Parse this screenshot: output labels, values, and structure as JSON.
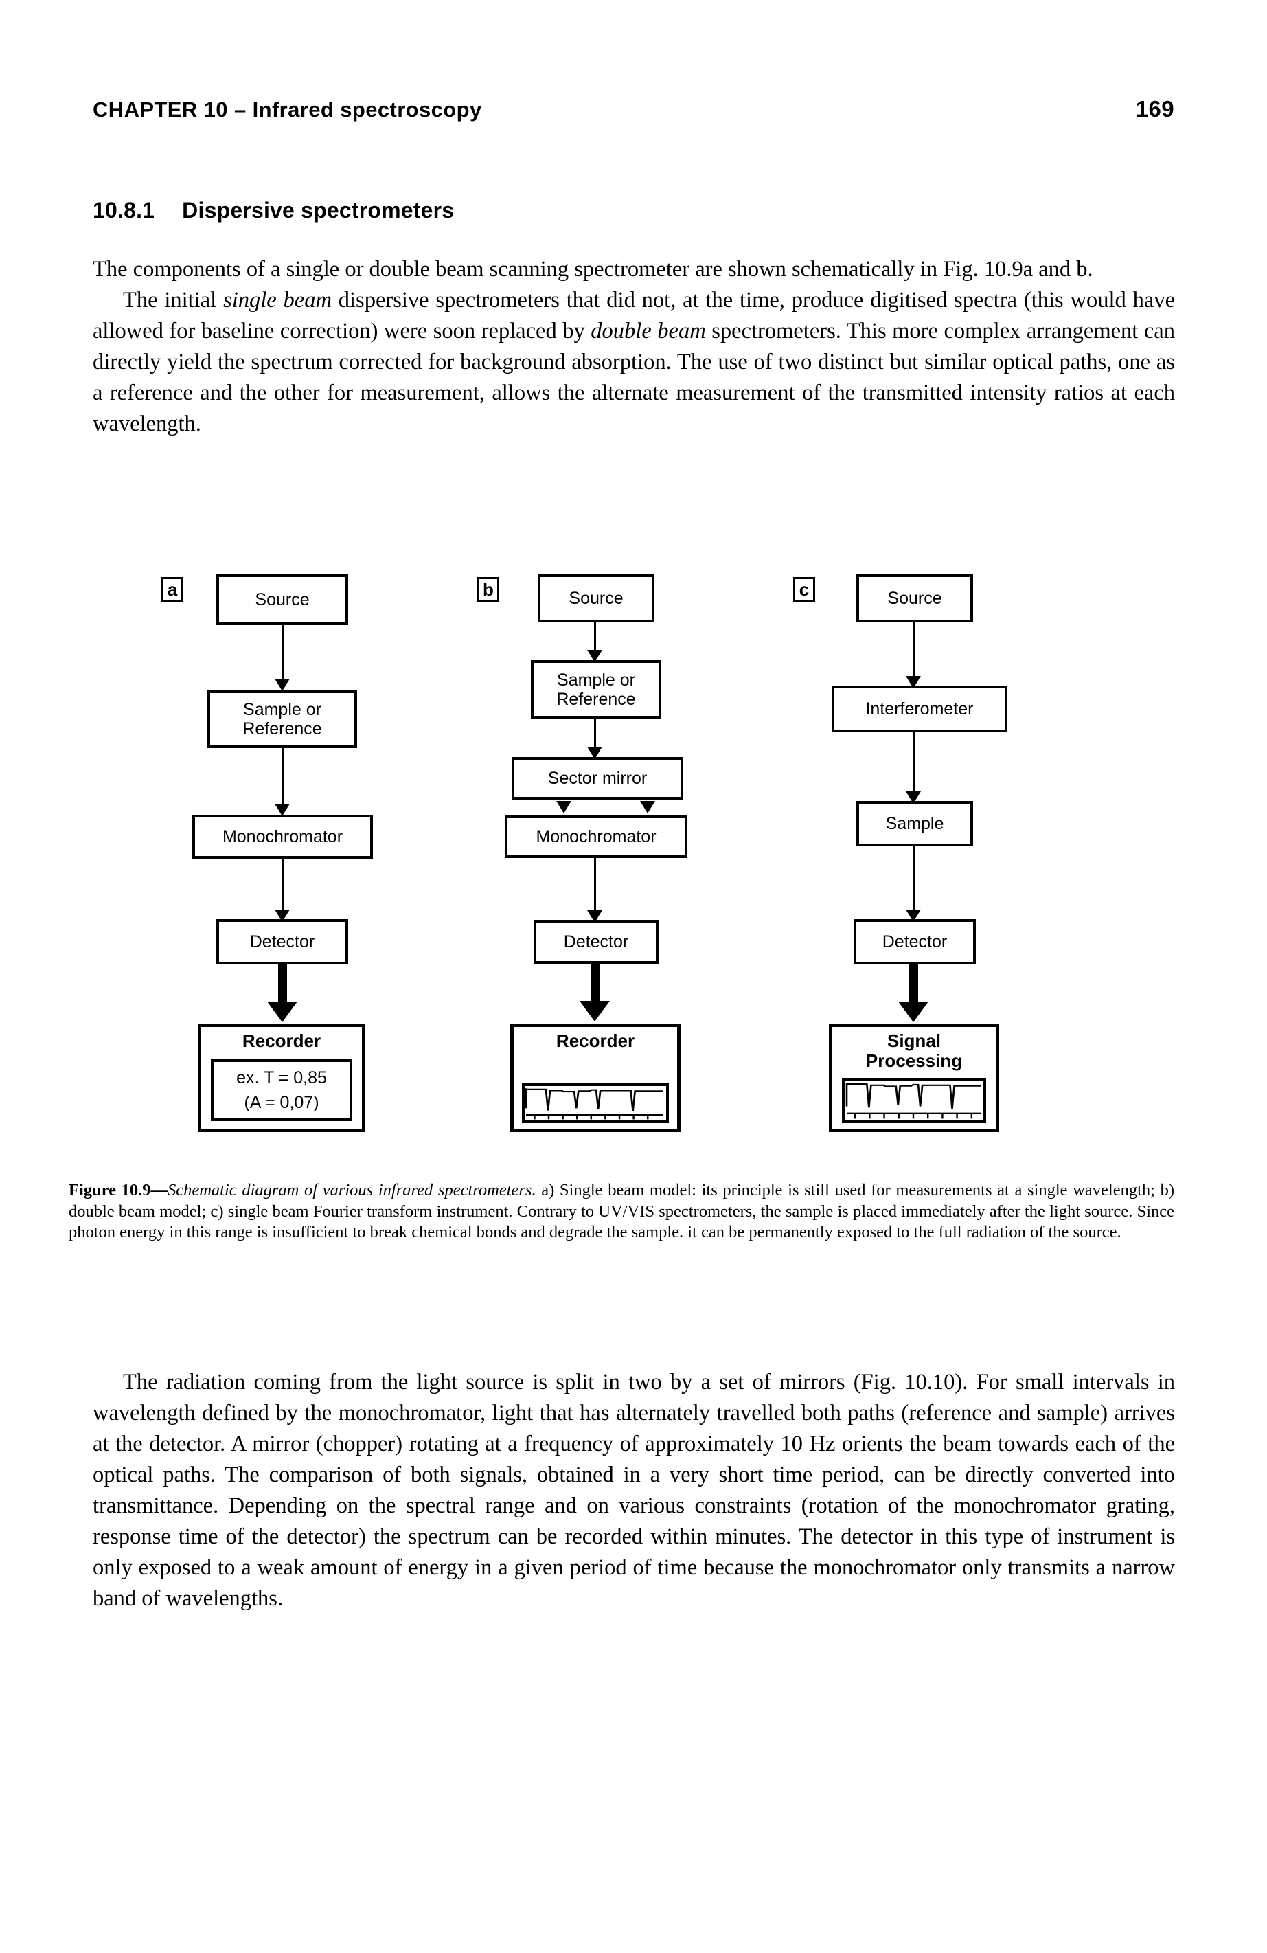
{
  "runhead": {
    "chapter": "CHAPTER 10 – Infrared spectroscopy",
    "page_number": "169"
  },
  "section": {
    "number": "10.8.1",
    "title": "Dispersive spectrometers"
  },
  "paragraphs": {
    "p1_line1": "The components of a single or double beam scanning spectrometer are shown schematically in Fig. 10.9a and b.",
    "p1_a": "The initial ",
    "p1_em1": "single beam",
    "p1_b": " dispersive spectrometers that did not, at the time, produce digitised spectra (this would have allowed for baseline correction) were soon replaced by ",
    "p1_em2": "double beam",
    "p1_c": " spectrometers. This more complex arrangement can directly yield the spectrum corrected for background absorption. The use of two distinct but similar optical paths, one as a reference and the other for measurement, allows the alternate measurement of the transmitted intensity ratios at each wavelength.",
    "p2": "The radiation coming from the light source is split in two by a set of mirrors (Fig. 10.10). For small intervals in wavelength defined by the monochromator, light that has alternately travelled both paths (reference and sample) arrives at the detector. A mirror (chopper) rotating at a frequency of approximately 10 Hz orients the beam towards each of the optical paths. The comparison of both signals, obtained in a very short time period, can be directly converted into transmittance. Depending on the spectral range and on various constraints (rotation of the monochromator grating, response time of the detector) the spectrum can be recorded within minutes. The detector in this type of instrument is only exposed to a weak amount of energy in a given period of time because the monochromator only transmits a narrow band of wavelengths."
  },
  "figure": {
    "panels": [
      {
        "tag": "a",
        "boxes": [
          {
            "label": "Source"
          },
          {
            "label": "Sample or\nReference"
          },
          {
            "label": "Monochromator"
          },
          {
            "label": "Detector"
          }
        ],
        "recorder": {
          "title": "Recorder",
          "inner_line1": "ex. T = 0,85",
          "inner_line2": "(A = 0,07)",
          "has_spectrum": false
        }
      },
      {
        "tag": "b",
        "boxes": [
          {
            "label": "Source"
          },
          {
            "label": "Sample or\nReference"
          },
          {
            "label": "Sector mirror"
          },
          {
            "label": "Monochromator"
          },
          {
            "label": "Detector"
          }
        ],
        "recorder": {
          "title": "Recorder",
          "has_spectrum": true
        }
      },
      {
        "tag": "c",
        "boxes": [
          {
            "label": "Source"
          },
          {
            "label": "Interferometer"
          },
          {
            "label": "Sample"
          },
          {
            "label": "Detector"
          }
        ],
        "recorder": {
          "title": "Signal\nProcessing",
          "has_spectrum": true
        }
      }
    ]
  },
  "caption": {
    "label": "Figure 10.9—",
    "italic_title": "Schematic diagram of various infrared spectrometers.",
    "rest": " a) Single beam model: its principle is still used for measurements at a single wavelength; b) double beam model; c) single beam Fourier transform instrument. Contrary to UV/VIS spectrometers, the sample is placed immediately after the light source. Since photon energy in this range is insufficient to break chemical bonds and degrade the sample. it can be permanently exposed to the full radiation of the source."
  },
  "colors": {
    "ink": "#000000",
    "paper": "#ffffff"
  }
}
